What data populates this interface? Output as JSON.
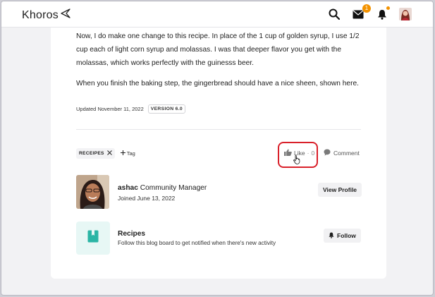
{
  "header": {
    "logo_text": "Khoros",
    "messages_badge": "1"
  },
  "post": {
    "paragraph_1": "Now, I do make one change to this recipe. In place of the 1 cup of golden syrup, I use 1/2 cup each of light corn syrup and molassas. I was that deeper flavor you get with the molassas, which works perfectly with the guinesss beer.",
    "paragraph_2": "When you finish the baking step, the gingerbread should have a nice sheen, shown here.",
    "updated": "Updated November 11, 2022",
    "version": "VERSION 6.0"
  },
  "tags": {
    "items": [
      "RECEIPES"
    ],
    "add_label": "Tag"
  },
  "actions": {
    "like_label": "Like",
    "like_separator": "·",
    "like_count": "0",
    "comment_label": "Comment"
  },
  "author": {
    "name": "ashac",
    "role": "Community Manager",
    "joined": "Joined June 13, 2022",
    "view_profile_label": "View Profile"
  },
  "board": {
    "title": "Recipes",
    "description": "Follow this blog board to get notified when there's new activity",
    "follow_label": "Follow"
  },
  "colors": {
    "accent_badge": "#f39200",
    "highlight": "#d9202a",
    "board_icon": "#2bb5a5"
  }
}
